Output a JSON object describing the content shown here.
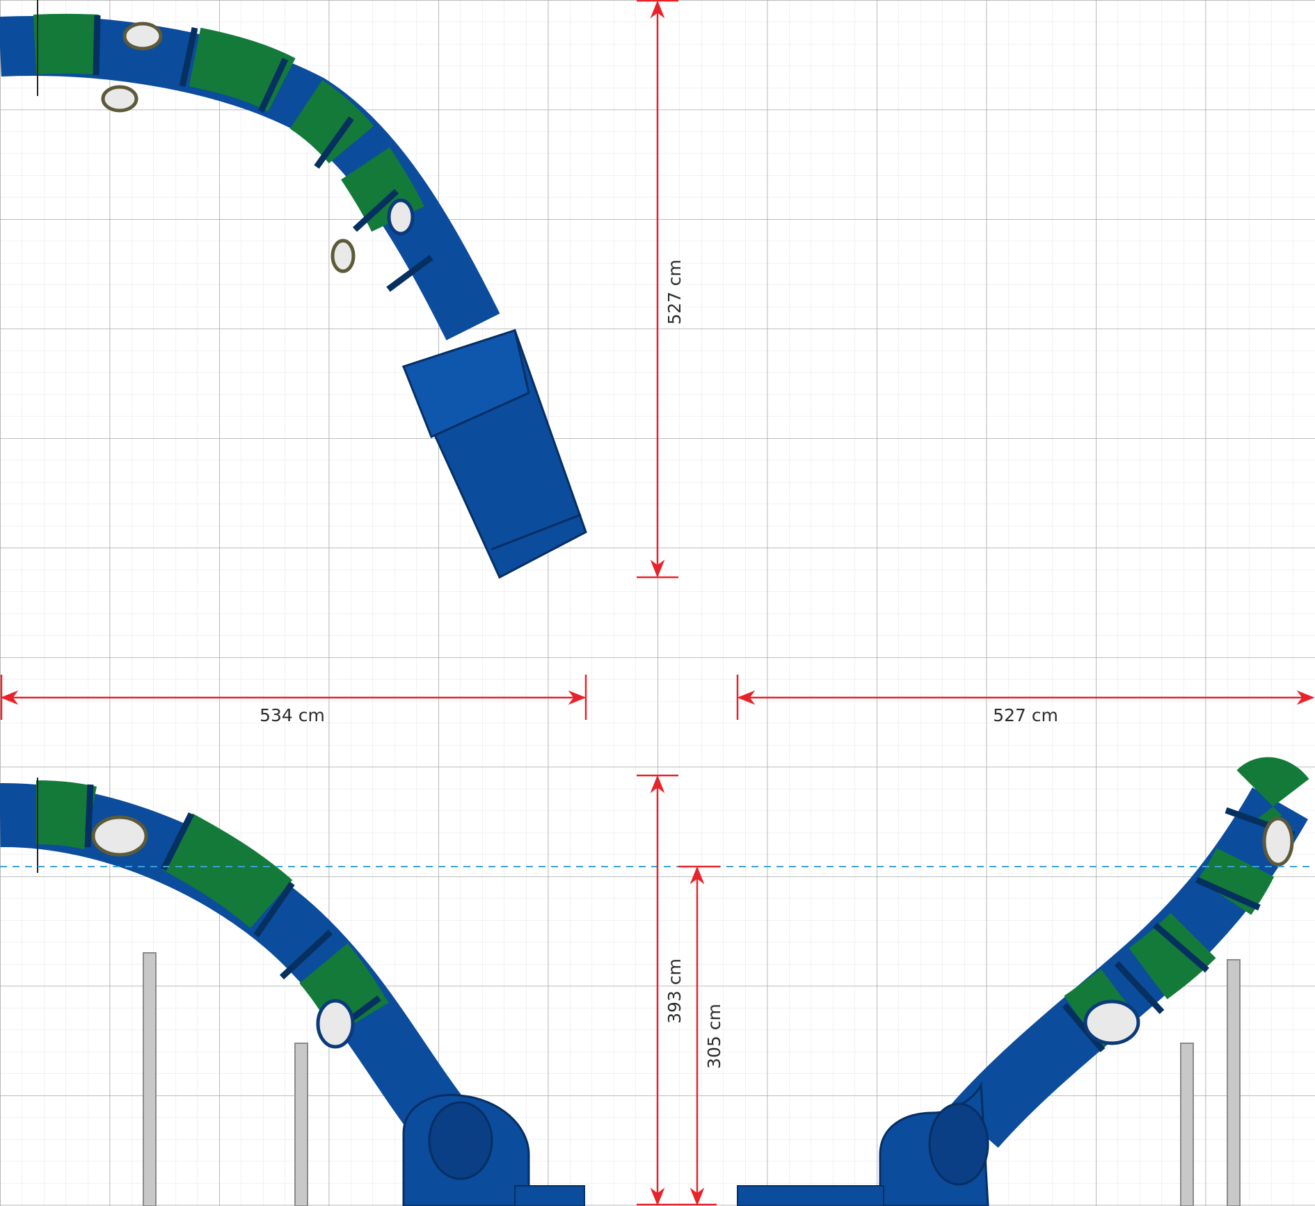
{
  "dimensions": {
    "top_view_height": "527 cm",
    "top_view_width_left": "534 cm",
    "top_view_width_right": "527 cm",
    "side_view_total_height": "393 cm",
    "side_view_platform_height": "305 cm"
  },
  "colors": {
    "background": "#ffffff",
    "grid_minor": "#e4e4e4",
    "grid_major": "#a6a6a6",
    "dimension_line": "#e8222a",
    "reference_line": "#3aa0d8",
    "tube_blue": "#0b4c9c",
    "tube_green": "#137a3a",
    "post": "#c8c8c8"
  }
}
